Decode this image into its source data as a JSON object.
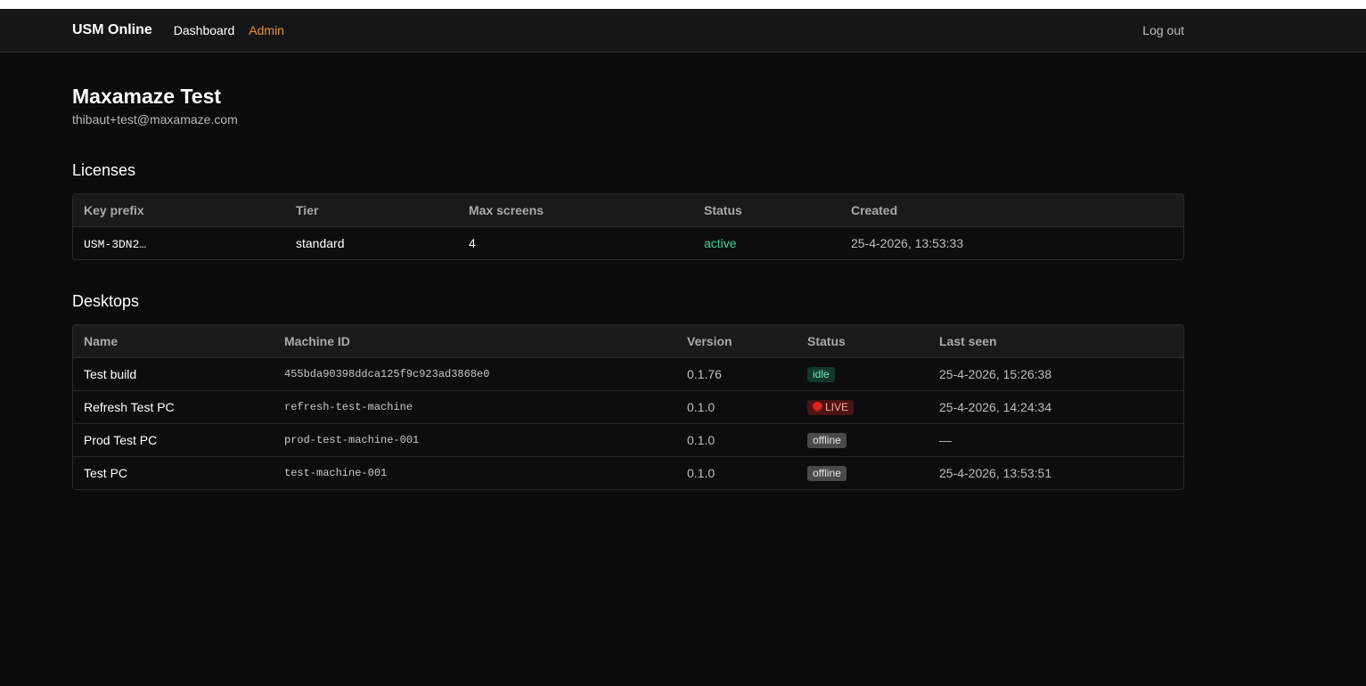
{
  "nav": {
    "brand": "USM Online",
    "links": [
      "Dashboard",
      "Admin"
    ],
    "logout": "Log out"
  },
  "customer": {
    "name": "Maxamaze Test",
    "email": "thibaut+test@maxamaze.com"
  },
  "licenses": {
    "title": "Licenses",
    "columns": [
      "Key prefix",
      "Tier",
      "Max screens",
      "Status",
      "Created"
    ],
    "rows": [
      {
        "key_prefix": "USM-3DN2…",
        "tier": "standard",
        "max_screens": "4",
        "status": "active",
        "created": "25-4-2026, 13:53:33"
      }
    ]
  },
  "desktops": {
    "title": "Desktops",
    "columns": [
      "Name",
      "Machine ID",
      "Version",
      "Status",
      "Last seen"
    ],
    "rows": [
      {
        "name": "Test build",
        "machine_id": "455bda90398ddca125f9c923ad3868e0",
        "version": "0.1.76",
        "status": "idle",
        "last_seen": "25-4-2026, 15:26:38"
      },
      {
        "name": "Refresh Test PC",
        "machine_id": "refresh-test-machine",
        "version": "0.1.0",
        "status": "LIVE",
        "last_seen": "25-4-2026, 14:24:34"
      },
      {
        "name": "Prod Test PC",
        "machine_id": "prod-test-machine-001",
        "version": "0.1.0",
        "status": "offline",
        "last_seen": "—"
      },
      {
        "name": "Test PC",
        "machine_id": "test-machine-001",
        "version": "0.1.0",
        "status": "offline",
        "last_seen": "25-4-2026, 13:53:51"
      }
    ]
  },
  "colors": {
    "background": "#0b0b0d",
    "navbar": "#161618",
    "admin_link": "#e8913a",
    "active_status": "#34d399",
    "idle_badge": "#123a2c",
    "live_badge": "#4a1515",
    "live_dot": "#e02424",
    "offline_badge": "#4a4a4e"
  },
  "icons": {
    "live_indicator": "red-circle-icon"
  }
}
